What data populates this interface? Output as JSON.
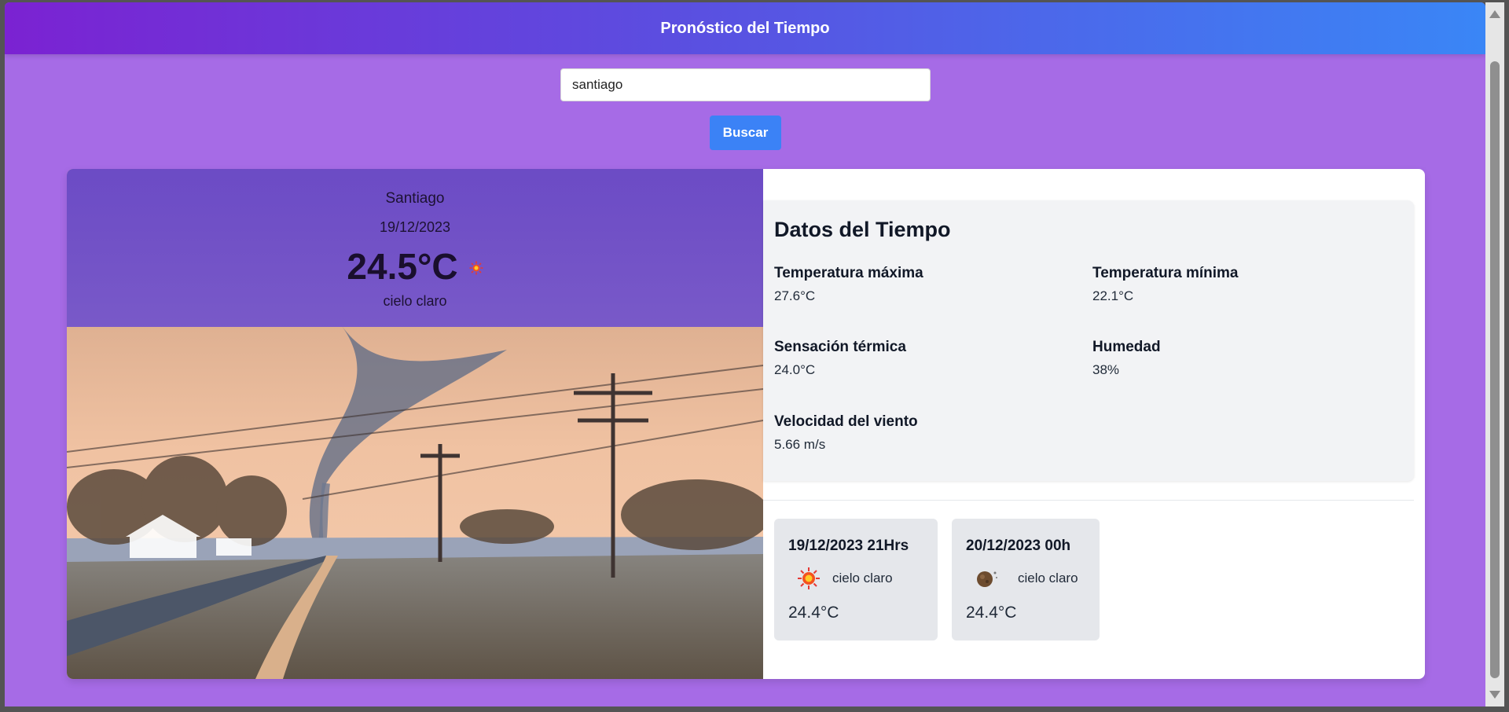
{
  "header": {
    "title": "Pronóstico del Tiempo"
  },
  "search": {
    "value": "santiago",
    "button_label": "Buscar"
  },
  "current": {
    "city": "Santiago",
    "date": "19/12/2023",
    "temperature": "24.5°C",
    "description": "cielo claro",
    "icon": "sun-icon"
  },
  "details": {
    "title": "Datos del Tiempo",
    "items": [
      {
        "label": "Temperatura máxima",
        "value": "27.6°C"
      },
      {
        "label": "Temperatura mínima",
        "value": "22.1°C"
      },
      {
        "label": "Sensación térmica",
        "value": "24.0°C"
      },
      {
        "label": "Humedad",
        "value": "38%"
      },
      {
        "label": "Velocidad del viento",
        "value": "5.66 m/s"
      }
    ]
  },
  "forecast": [
    {
      "date": "19/12/2023 21Hrs",
      "description": "cielo claro",
      "temperature": "24.4°C",
      "icon": "sun-icon"
    },
    {
      "date": "20/12/2023 00h",
      "description": "cielo claro",
      "temperature": "24.4°C",
      "icon": "moon-icon"
    }
  ],
  "colors": {
    "header_start": "#7b22d2",
    "header_end": "#3a86f6",
    "page_background": "#a66be6",
    "button": "#3b82f6"
  }
}
